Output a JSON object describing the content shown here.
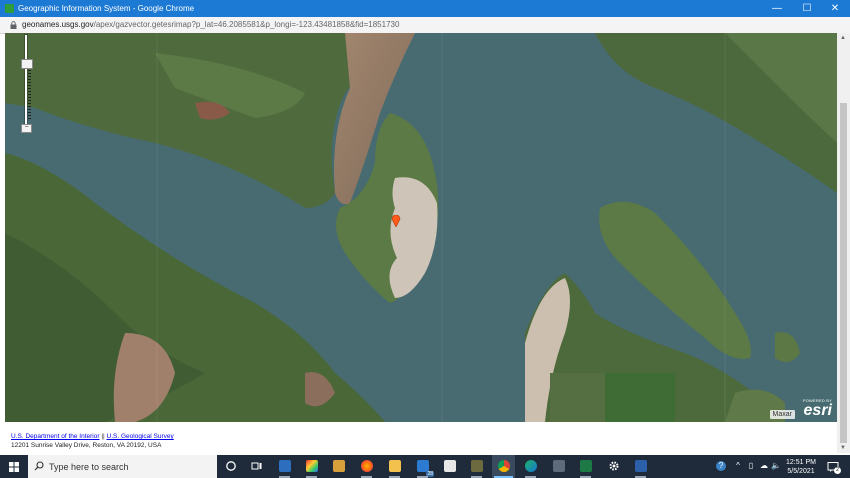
{
  "window": {
    "title": "Geographic Information System - Google Chrome",
    "controls": {
      "minimize": "—",
      "maximize": "☐",
      "close": "✕"
    }
  },
  "address_bar": {
    "host": "geonames.usgs.gov",
    "path": "/apex/gazvector.getesrimap?p_lat=46.2085581&p_longi=-123.43481858&fid=1851730"
  },
  "map": {
    "zoom_out_label": "−",
    "attribution": "Maxar",
    "esri_powered": "POWERED BY",
    "esri_word": "esri",
    "colors": {
      "water": "#486c71",
      "land": "#4e6b3e",
      "sand": "#c9bdb2",
      "marker": "#ff5a1a"
    }
  },
  "footer": {
    "link_interior": "U.S. Department of the Interior",
    "separator": "||",
    "link_usgs": "U.S. Geological Survey",
    "address": "12201 Sunrise Valley Drive, Reston, VA 20192, USA"
  },
  "taskbar": {
    "search_placeholder": "Type here to search",
    "mail_badge": "28",
    "time": "12:51 PM",
    "date": "5/5/2021",
    "notification_count": "2"
  }
}
